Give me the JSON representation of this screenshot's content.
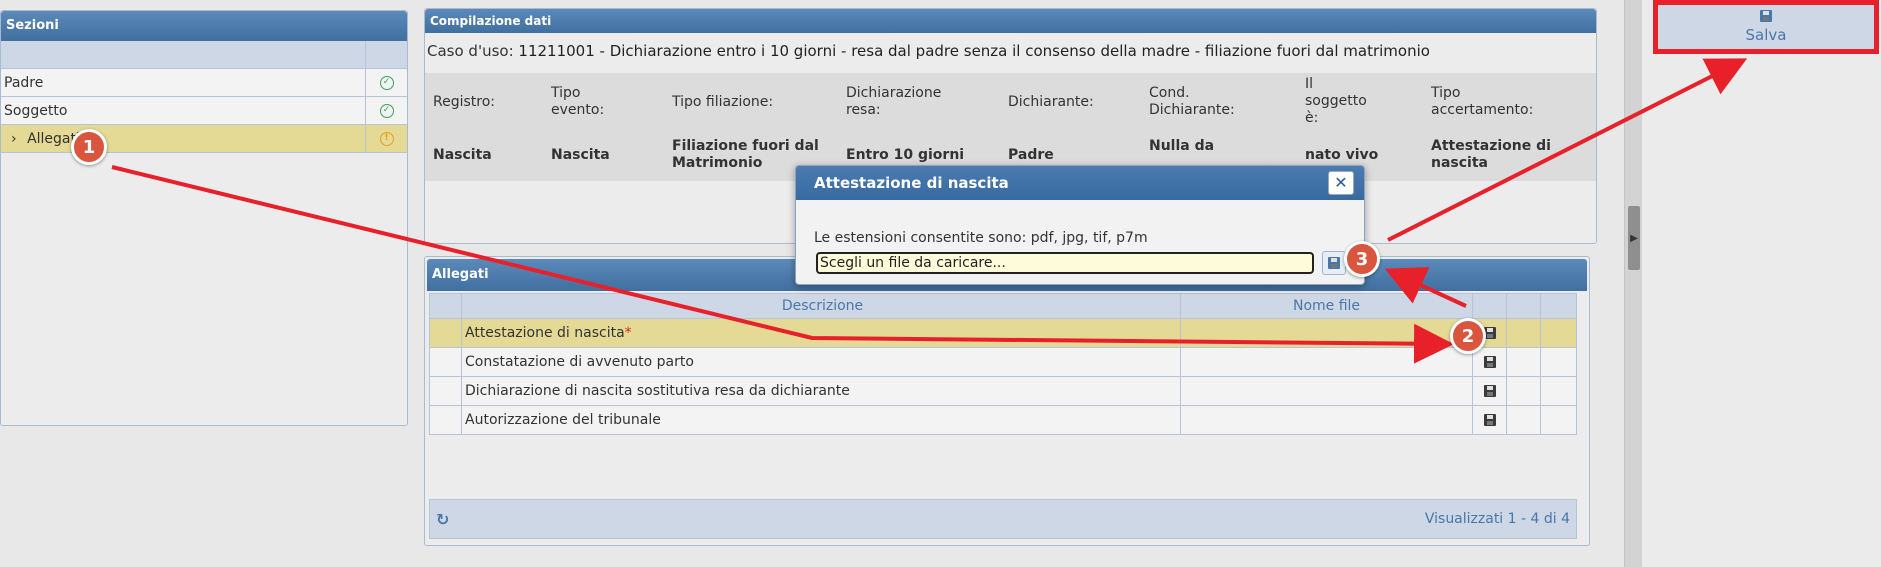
{
  "sezioni": {
    "title": "Sezioni",
    "items": [
      {
        "label": "Padre",
        "status": "check-icon"
      },
      {
        "label": "Soggetto",
        "status": "check-icon"
      },
      {
        "label": "Allegati",
        "status": "warning-icon",
        "chevron": "›"
      }
    ]
  },
  "compilazione": {
    "title": "Compilazione dati",
    "caso_label": "Caso d'uso:",
    "caso_value": "11211001 - Dichiarazione entro i 10 giorni - resa dal padre senza il consenso della madre - filiazione fuori dal matrimonio",
    "fields": [
      {
        "label": "Registro:",
        "value": "Nascita"
      },
      {
        "label": "Tipo evento:",
        "value": "Nascita"
      },
      {
        "label": "Tipo filiazione:",
        "value": "Filiazione fuori dal Matrimonio"
      },
      {
        "label": "Dichiarazione resa:",
        "value": "Entro 10 giorni"
      },
      {
        "label": "Dichiarante:",
        "value": "Padre"
      },
      {
        "label": "Cond. Dichiarante:",
        "value": "Nulla da"
      },
      {
        "label": "Il soggetto è:",
        "value": "nato vivo"
      },
      {
        "label": "Tipo accertamento:",
        "value": "Attestazione di nascita"
      }
    ]
  },
  "allegati": {
    "title": "Allegati",
    "columns": [
      "Descrizione",
      "Nome file"
    ],
    "rows": [
      {
        "descrizione": "Attestazione di nascita",
        "required": "*",
        "nome_file": ""
      },
      {
        "descrizione": "Constatazione di avvenuto parto",
        "required": "",
        "nome_file": ""
      },
      {
        "descrizione": "Dichiarazione di nascita sostitutiva resa da dichiarante",
        "required": "",
        "nome_file": ""
      },
      {
        "descrizione": "Autorizzazione del tribunale",
        "required": "",
        "nome_file": ""
      }
    ],
    "footer": "Visualizzati 1 - 4 di 4"
  },
  "dialog": {
    "title": "Attestazione di nascita",
    "close": "✕",
    "message": "Le estensioni consentite sono: pdf, jpg, tif, p7m",
    "file_placeholder": "Scegli un file da caricare..."
  },
  "toolbar": {
    "save_label": "Salva"
  },
  "markers": [
    "1",
    "2",
    "3"
  ],
  "colors": {
    "header_blue": "#41709f",
    "selected_row": "#e4d995",
    "annotation_red": "#e8202a"
  }
}
